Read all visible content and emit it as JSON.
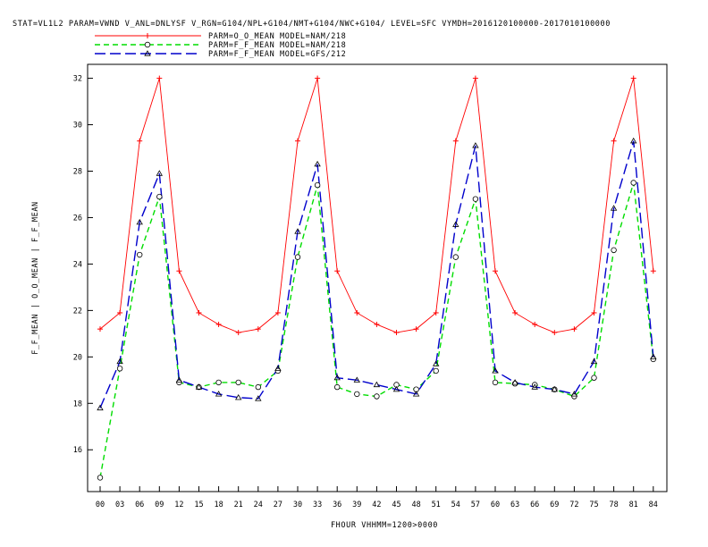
{
  "header": {
    "title": "STAT=VL1L2 PARAM=VWND V_ANL=DNLYSF V_RGN=G104/NPL+G104/NMT+G104/NWC+G104/ LEVEL=SFC VYMDH=2016120100000-2017010100000"
  },
  "chart_data": {
    "type": "line",
    "title": "STAT=VL1L2 PARAM=VWND V_ANL=DNLYSF V_RGN=G104/NPL+G104/NMT+G104/NWC+G104/ LEVEL=SFC VYMDH=2016120100000-2017010100000",
    "xlabel": "FHOUR VHHMM=1200>0000",
    "ylabel": "F_F_MEAN | O_O_MEAN | F_F_MEAN",
    "categories": [
      "00",
      "03",
      "06",
      "09",
      "12",
      "15",
      "18",
      "21",
      "24",
      "27",
      "30",
      "33",
      "36",
      "39",
      "42",
      "45",
      "48",
      "51",
      "54",
      "57",
      "60",
      "63",
      "66",
      "69",
      "72",
      "75",
      "78",
      "81",
      "84"
    ],
    "ylim": [
      14.2,
      32.6
    ],
    "yticks": [
      "16",
      "18",
      "20",
      "22",
      "24",
      "26",
      "28",
      "30",
      "32"
    ],
    "grid": false,
    "legend_position": "top-left",
    "series": [
      {
        "name": "PARM=O_O_MEAN MODEL=NAM/218",
        "color": "#ff0000",
        "dash": "solid",
        "marker": "plus",
        "values": [
          21.2,
          21.9,
          29.3,
          32.0,
          23.7,
          21.9,
          21.4,
          21.05,
          21.2,
          21.9,
          29.3,
          32.0,
          23.7,
          21.9,
          21.4,
          21.05,
          21.2,
          21.9,
          29.3,
          32.0,
          23.7,
          21.9,
          21.4,
          21.05,
          21.2,
          21.9,
          29.3,
          32.0,
          23.7
        ]
      },
      {
        "name": "PARM=F_F_MEAN MODEL=NAM/218",
        "color": "#00dd00",
        "dash": "dashed",
        "marker": "circle",
        "values": [
          14.8,
          19.5,
          24.4,
          26.9,
          18.9,
          18.7,
          18.9,
          18.9,
          18.7,
          19.4,
          24.3,
          27.4,
          18.7,
          18.4,
          18.3,
          18.8,
          18.6,
          19.4,
          24.3,
          26.8,
          18.9,
          18.85,
          18.8,
          18.6,
          18.3,
          19.1,
          24.6,
          27.5,
          19.9
        ]
      },
      {
        "name": "PARM=F_F_MEAN MODEL=GFS/212",
        "color": "#0000cc",
        "dash": "dashed",
        "marker": "triangle",
        "values": [
          17.8,
          19.8,
          25.8,
          27.9,
          19.0,
          18.7,
          18.4,
          18.25,
          18.2,
          19.5,
          25.4,
          28.3,
          19.1,
          19.0,
          18.8,
          18.6,
          18.4,
          19.7,
          25.7,
          29.1,
          19.4,
          18.9,
          18.7,
          18.6,
          18.4,
          19.8,
          26.4,
          29.3,
          20.0
        ]
      }
    ]
  }
}
